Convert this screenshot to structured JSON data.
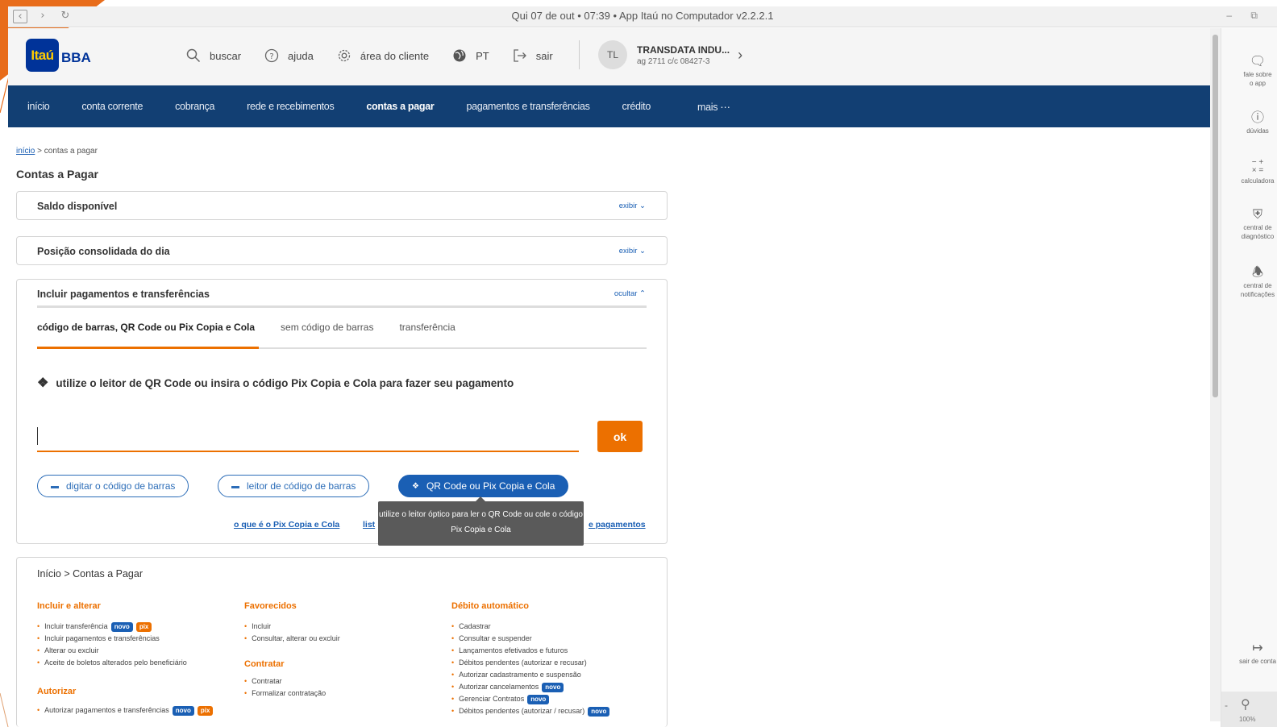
{
  "window": {
    "title": "Qui 07 de out • 07:39 • App Itaú no Computador v2.2.2.1",
    "controls": "– ⧉"
  },
  "logo": {
    "brand": "Itaú",
    "suffix": "BBA"
  },
  "header": {
    "search": "buscar",
    "help": "ajuda",
    "client_area": "área do cliente",
    "lang": "PT",
    "logout": "sair",
    "user": {
      "initials": "TL",
      "name": "TRANSDATA INDU...",
      "account": "ag 2711  c/c 08427-3"
    }
  },
  "nav": [
    "início",
    "conta corrente",
    "cobrança",
    "rede e recebimentos",
    "contas a pagar",
    "pagamentos e transferências",
    "crédito",
    "mais ⋯"
  ],
  "breadcrumb": {
    "home": "início",
    "current": " > contas a pagar"
  },
  "page_title": "Contas a Pagar",
  "cards": {
    "saldo": {
      "title": "Saldo disponível",
      "toggle": "exibir"
    },
    "posicao": {
      "title": "Posição consolidada do dia",
      "toggle": "exibir"
    },
    "incluir": {
      "title": "Incluir pagamentos e transferências",
      "toggle": "ocultar",
      "tabs": [
        "código de barras, QR Code ou Pix Copia e Cola",
        "sem código de barras",
        "transferência"
      ],
      "instruction": "utilize o leitor de QR Code ou insira o código Pix Copia e Cola para fazer seu pagamento",
      "input_value": "",
      "ok": "ok",
      "options": [
        "digitar o código de barras",
        "leitor de código de barras",
        "QR Code ou Pix Copia e Cola"
      ],
      "link_pix": "o que é o Pix Copia e Cola",
      "link_list_partial": "list",
      "link_payments_partial": "e pagamentos",
      "tooltip": "utilize o leitor óptico para ler o QR Code ou cole o código Pix Copia e Cola"
    }
  },
  "menu": {
    "title": "Início > Contas a Pagar",
    "col1": {
      "h1": "Incluir e alterar",
      "items1": [
        {
          "text": "Incluir transferência",
          "badges": [
            "novo",
            "pix"
          ]
        },
        {
          "text": "Incluir pagamentos e transferências",
          "badges": []
        },
        {
          "text": "Alterar ou excluir",
          "badges": []
        },
        {
          "text": "Aceite de boletos alterados pelo beneficiário",
          "badges": []
        }
      ],
      "h2": "Autorizar",
      "items2": [
        {
          "text": "Autorizar pagamentos e transferências",
          "badges": [
            "novo",
            "pix"
          ]
        }
      ]
    },
    "col2": {
      "h1": "Favorecidos",
      "items1": [
        "Incluir",
        "Consultar, alterar ou excluir"
      ],
      "h2": "Contratar",
      "items2": [
        "Contratar",
        "Formalizar contratação"
      ]
    },
    "col3": {
      "h1": "Débito automático",
      "items": [
        {
          "text": "Cadastrar",
          "badges": []
        },
        {
          "text": "Consultar e suspender",
          "badges": []
        },
        {
          "text": "Lançamentos efetivados e futuros",
          "badges": []
        },
        {
          "text": "Débitos pendentes (autorizar e recusar)",
          "badges": []
        },
        {
          "text": "Autorizar cadastramento e suspensão",
          "badges": []
        },
        {
          "text": "Autorizar cancelamentos",
          "badges": [
            "novo"
          ]
        },
        {
          "text": "Gerenciar Contratos",
          "badges": [
            "novo"
          ]
        },
        {
          "text": "Débitos pendentes (autorizar / recusar)",
          "badges": [
            "novo"
          ]
        }
      ]
    }
  },
  "sidebar": [
    {
      "icon": "chat-icon",
      "label": "fale sobre\no app"
    },
    {
      "icon": "question-icon",
      "label": "dúvidas"
    },
    {
      "icon": "calculator-icon",
      "label": "calculadora"
    },
    {
      "icon": "shield-icon",
      "label": "central de\ndiagnóstico"
    },
    {
      "icon": "bell-icon",
      "label": "central de\nnotificações"
    },
    {
      "icon": "exit-icon",
      "label": "sair de conta"
    }
  ],
  "zoom": "100%",
  "colors": {
    "brand_blue": "#123f73",
    "orange": "#ec7000",
    "link_blue": "#1a5fb4"
  }
}
